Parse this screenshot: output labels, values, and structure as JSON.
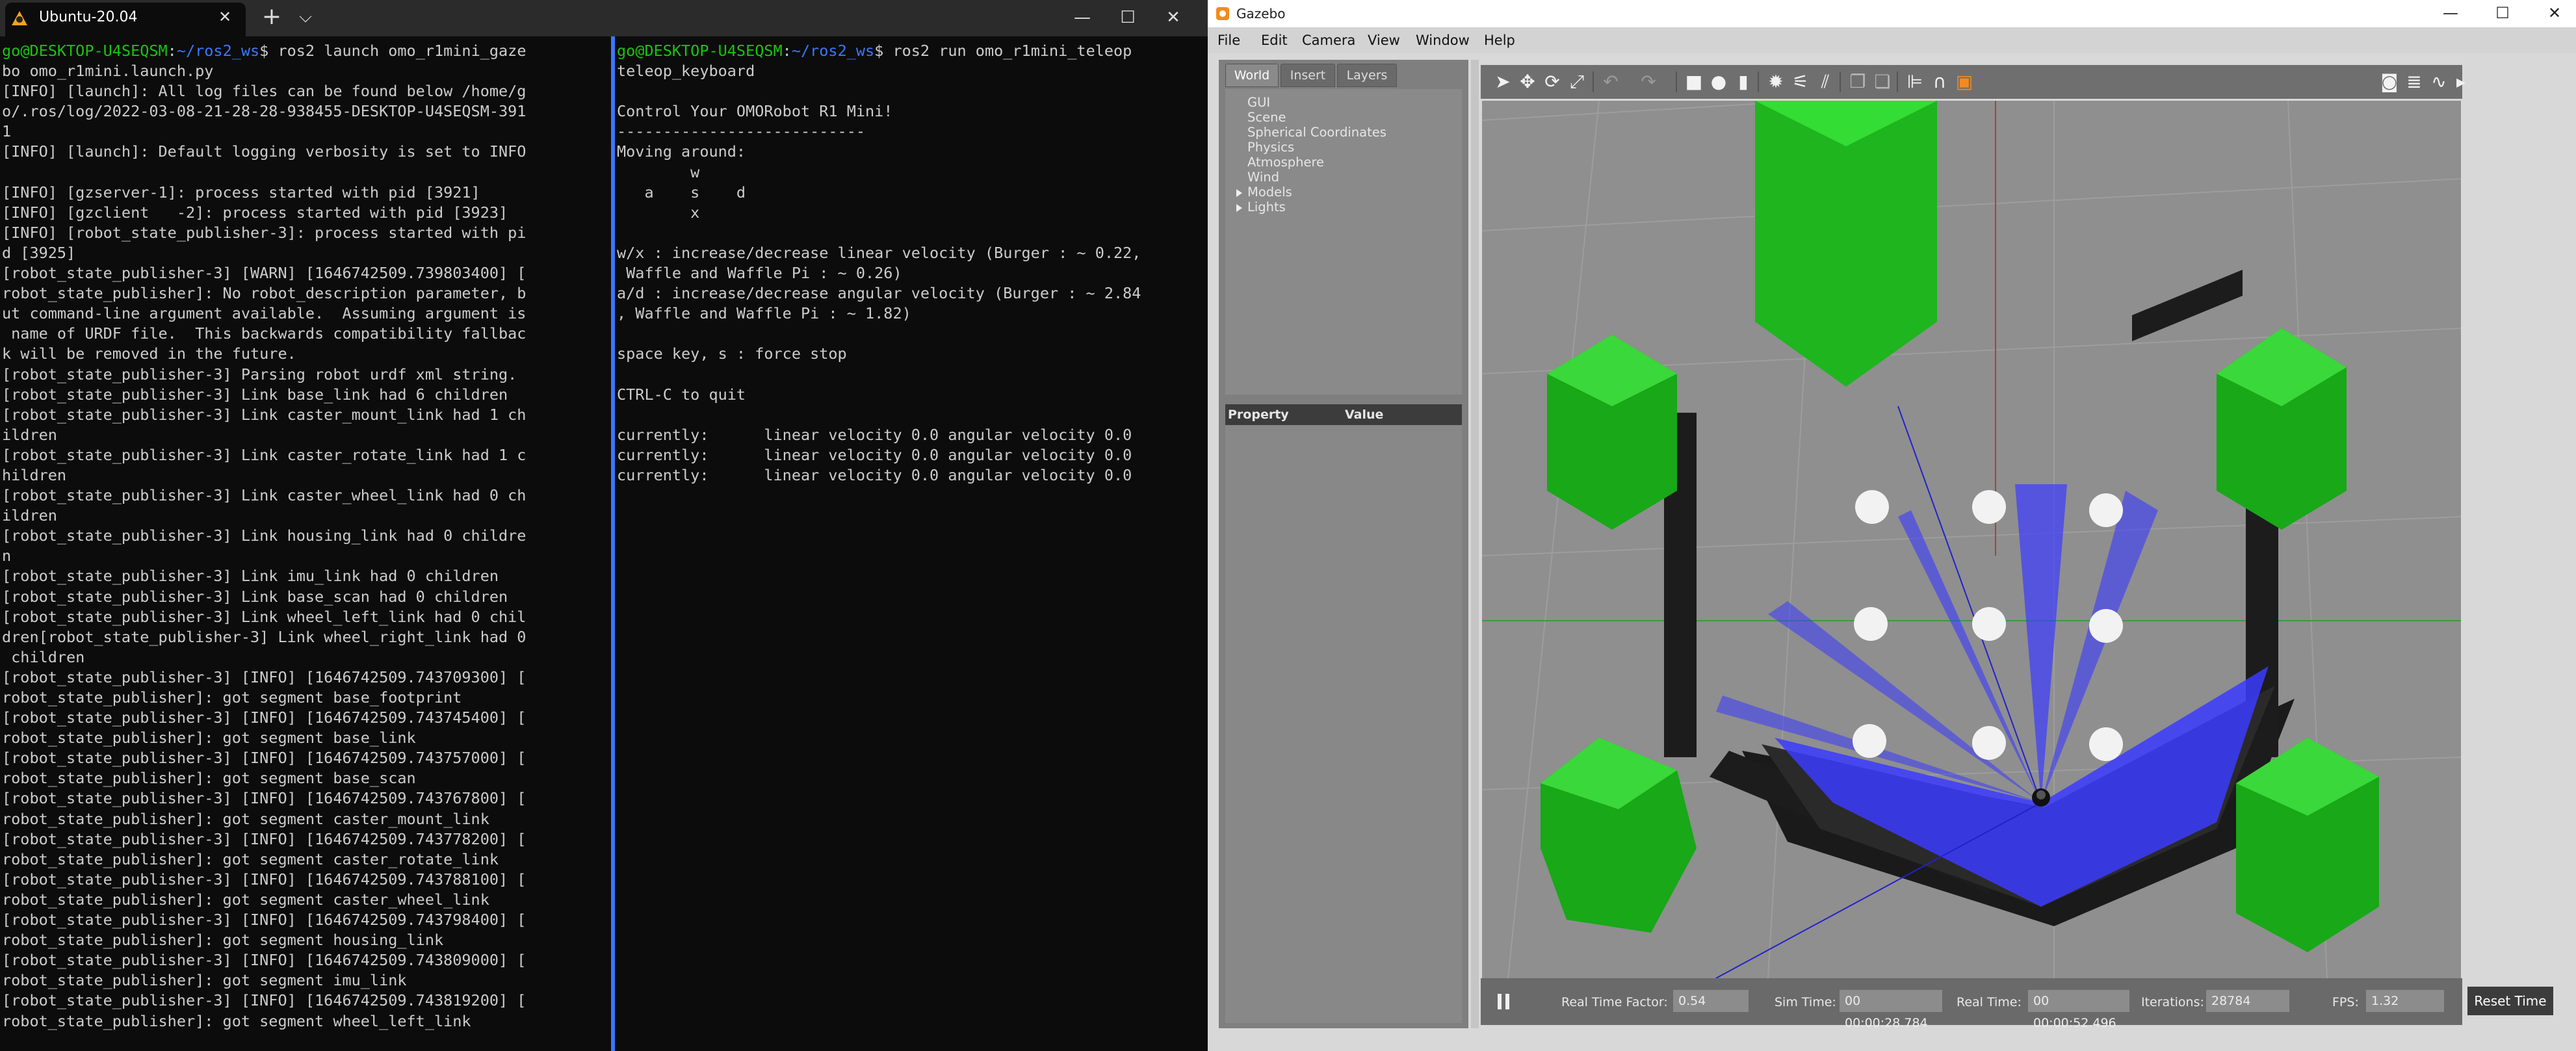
{
  "terminal": {
    "tab_title": "Ubuntu-20.04",
    "tab_close": "✕",
    "new_tab": "+",
    "dropdown": "⌵",
    "window_controls": {
      "minimize": "—",
      "maximize": "☐",
      "close": "✕"
    },
    "left_pane": {
      "prompt_user": "go@DESKTOP-U4SEQSM",
      "prompt_sep": ":",
      "prompt_path": "~/ros2_ws",
      "prompt_cmd": "$ ros2 launch omo_r1mini_gaze",
      "lines": [
        "bo omo_r1mini.launch.py",
        "[INFO] [launch]: All log files can be found below /home/g",
        "o/.ros/log/2022-03-08-21-28-28-938455-DESKTOP-U4SEQSM-391",
        "1",
        "[INFO] [launch]: Default logging verbosity is set to INFO",
        "",
        "[INFO] [gzserver-1]: process started with pid [3921]",
        "[INFO] [gzclient   -2]: process started with pid [3923]",
        "[INFO] [robot_state_publisher-3]: process started with pi",
        "d [3925]",
        "[robot_state_publisher-3] [WARN] [1646742509.739803400] [",
        "robot_state_publisher]: No robot_description parameter, b",
        "ut command-line argument available.  Assuming argument is",
        " name of URDF file.  This backwards compatibility fallbac",
        "k will be removed in the future.",
        "[robot_state_publisher-3] Parsing robot urdf xml string.",
        "[robot_state_publisher-3] Link base_link had 6 children",
        "[robot_state_publisher-3] Link caster_mount_link had 1 ch",
        "ildren",
        "[robot_state_publisher-3] Link caster_rotate_link had 1 c",
        "hildren",
        "[robot_state_publisher-3] Link caster_wheel_link had 0 ch",
        "ildren",
        "[robot_state_publisher-3] Link housing_link had 0 childre",
        "n",
        "[robot_state_publisher-3] Link imu_link had 0 children",
        "[robot_state_publisher-3] Link base_scan had 0 children",
        "[robot_state_publisher-3] Link wheel_left_link had 0 chil",
        "dren[robot_state_publisher-3] Link wheel_right_link had 0",
        " children",
        "[robot_state_publisher-3] [INFO] [1646742509.743709300] [",
        "robot_state_publisher]: got segment base_footprint",
        "[robot_state_publisher-3] [INFO] [1646742509.743745400] [",
        "robot_state_publisher]: got segment base_link",
        "[robot_state_publisher-3] [INFO] [1646742509.743757000] [",
        "robot_state_publisher]: got segment base_scan",
        "[robot_state_publisher-3] [INFO] [1646742509.743767800] [",
        "robot_state_publisher]: got segment caster_mount_link",
        "[robot_state_publisher-3] [INFO] [1646742509.743778200] [",
        "robot_state_publisher]: got segment caster_rotate_link",
        "[robot_state_publisher-3] [INFO] [1646742509.743788100] [",
        "robot_state_publisher]: got segment caster_wheel_link",
        "[robot_state_publisher-3] [INFO] [1646742509.743798400] [",
        "robot_state_publisher]: got segment housing_link",
        "[robot_state_publisher-3] [INFO] [1646742509.743809000] [",
        "robot_state_publisher]: got segment imu_link",
        "[robot_state_publisher-3] [INFO] [1646742509.743819200] [",
        "robot_state_publisher]: got segment wheel_left_link"
      ]
    },
    "right_pane": {
      "prompt_user": "go@DESKTOP-U4SEQSM",
      "prompt_sep": ":",
      "prompt_path": "~/ros2_ws",
      "prompt_cmd": "$ ros2 run omo_r1mini_teleop",
      "lines": [
        "teleop_keyboard",
        "",
        "Control Your OMORobot R1 Mini!",
        "---------------------------",
        "Moving around:",
        "        w",
        "   a    s    d",
        "        x",
        "",
        "w/x : increase/decrease linear velocity (Burger : ~ 0.22,",
        " Waffle and Waffle Pi : ~ 0.26)",
        "a/d : increase/decrease angular velocity (Burger : ~ 2.84",
        ", Waffle and Waffle Pi : ~ 1.82)",
        "",
        "space key, s : force stop",
        "",
        "CTRL-C to quit",
        "",
        "currently:      linear velocity 0.0 angular velocity 0.0",
        "currently:      linear velocity 0.0 angular velocity 0.0",
        "currently:      linear velocity 0.0 angular velocity 0.0"
      ]
    },
    "colors": {
      "prompt_user": "#16c60c",
      "prompt_path": "#3b78ff",
      "text": "#cccccc",
      "background": "#0c0c0c"
    }
  },
  "gazebo": {
    "title": "Gazebo",
    "window_controls": {
      "minimize": "—",
      "maximize": "☐",
      "close": "✕"
    },
    "menu": [
      "File",
      "Edit",
      "Camera",
      "View",
      "Window",
      "Help"
    ],
    "tabs": [
      "World",
      "Insert",
      "Layers"
    ],
    "tree": {
      "items": [
        "GUI",
        "Scene",
        "Spherical Coordinates",
        "Physics",
        "Atmosphere",
        "Wind",
        "Models",
        "Lights"
      ]
    },
    "property_header": {
      "property": "Property",
      "value": "Value"
    },
    "toolbar_icons": [
      "select-arrow-icon",
      "translate-icon",
      "rotate-icon",
      "scale-icon",
      "undo-icon",
      "redo-icon",
      "box-icon",
      "sphere-icon",
      "cylinder-icon",
      "point-light-icon",
      "spot-light-icon",
      "directional-light-icon",
      "copy-icon",
      "paste-icon",
      "align-icon",
      "snap-icon",
      "change-view-icon",
      "screenshot-icon",
      "log-icon",
      "plot-icon",
      "record-icon"
    ],
    "status": {
      "real_time_factor_label": "Real Time Factor:",
      "real_time_factor": "0.54",
      "sim_time_label": "Sim Time:",
      "sim_time": "00 00:00:28.784",
      "real_time_label": "Real Time:",
      "real_time": "00 00:00:52.496",
      "iterations_label": "Iterations:",
      "iterations": "28784",
      "fps_label": "FPS:",
      "fps": "1.32",
      "reset_label": "Reset Time"
    },
    "colors": {
      "hex_green": "#19b319",
      "wall": "#1e1e1e",
      "laser": "#3b3bff",
      "ground": "#8f8f8f"
    }
  }
}
